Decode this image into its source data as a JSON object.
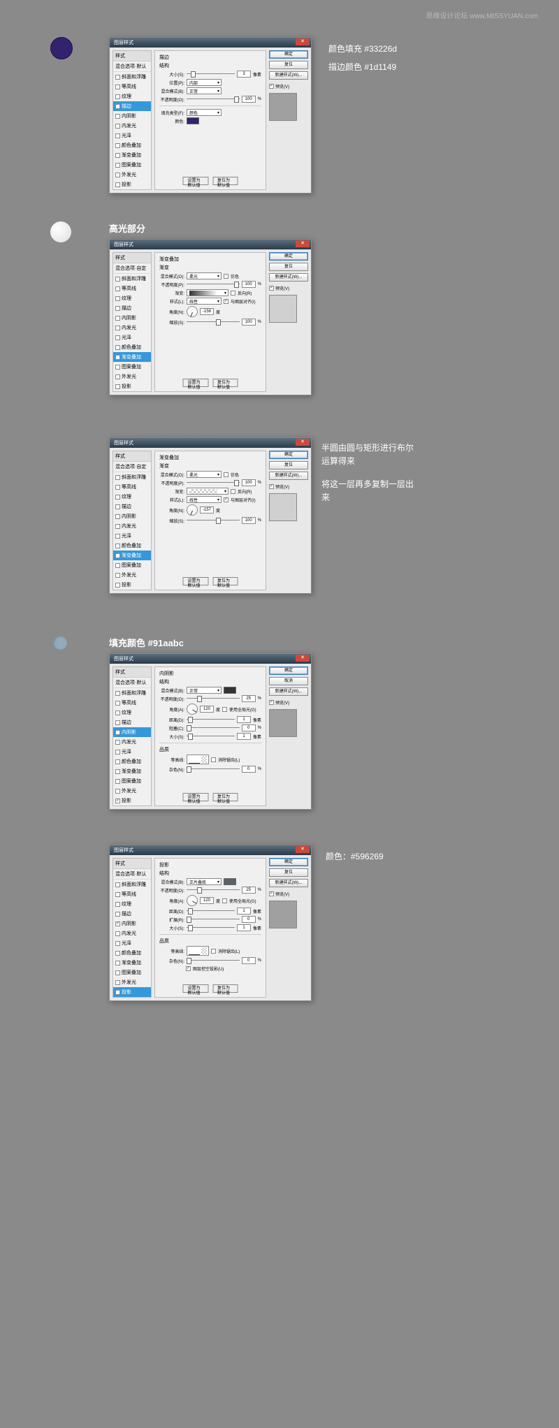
{
  "watermark": "思缘设计论坛 www.MISSYUAN.com",
  "dialogTitle": "图层样式",
  "stylesHeader": "样式",
  "blendDefault": "混合选项·默认",
  "blendCustom": "混合选项·自定",
  "styleItems": [
    "斜面和浮雕",
    "等高线",
    "纹理",
    "描边",
    "内阴影",
    "内发光",
    "光泽",
    "颜色叠加",
    "渐变叠加",
    "图案叠加",
    "外发光",
    "投影"
  ],
  "buttons": {
    "ok": "确定",
    "cancel": "取消",
    "reset": "复位",
    "newStyle": "新建样式(W)...",
    "preview": "预览(V)",
    "defaults": "设置为默认值",
    "resetDefaults": "复位为默认值"
  },
  "s1": {
    "panel": "描边",
    "struct": "结构",
    "size": "大小(S):",
    "sizeVal": "3",
    "pos": "位置(P):",
    "posVal": "内部",
    "blend": "混合模式(B):",
    "blendVal": "正常",
    "opacity": "不透明度(O):",
    "opacityVal": "100",
    "fillType": "填充类型(F):",
    "fillTypeVal": "颜色",
    "color": "颜色:",
    "px": "像素",
    "pct": "%",
    "annot1": "颜色填充 #33226d",
    "annot2": "描边颜色 #1d1149"
  },
  "hl": "高光部分",
  "s2": {
    "panel": "渐变叠加",
    "grad": "渐变",
    "blend": "混合模式(O):",
    "blendVal": "柔光",
    "dither": "仿色",
    "opacity": "不透明度(P):",
    "opacityVal": "100",
    "gradLbl": "渐变:",
    "reverse": "反向(R)",
    "style": "样式(L):",
    "styleVal": "线性",
    "align": "与图层对齐(I)",
    "angle": "角度(N):",
    "angleVal": "-158",
    "deg": "度",
    "scale": "缩放(S):",
    "scaleVal": "100",
    "pct": "%"
  },
  "s3": {
    "angleVal": "-157",
    "annot1": "半圆由圆与矩形进行布尔运算得来",
    "annot2": "将这一层再多复制一层出来"
  },
  "s4": {
    "title": "填充颜色 #91aabc",
    "panel": "内阴影",
    "struct": "结构",
    "blend": "混合模式(B):",
    "blendVal": "正常",
    "opacity": "不透明度(O):",
    "opacityVal": "25",
    "angle": "角度(A):",
    "angleVal": "120",
    "deg": "度",
    "global": "使用全局光(G)",
    "dist": "距离(D):",
    "distVal": "1",
    "px": "像素",
    "choke": "阻塞(C):",
    "chokeVal": "0",
    "size": "大小(S):",
    "sizeVal": "1",
    "quality": "品质",
    "contour": "等高线:",
    "anti": "消除锯齿(L)",
    "noise": "杂色(N):",
    "noiseVal": "0",
    "pct": "%"
  },
  "s5": {
    "panel": "投影",
    "struct": "结构",
    "blend": "混合模式(B):",
    "blendVal": "正片叠底",
    "opacity": "不透明度(O):",
    "opacityVal": "25",
    "angle": "角度(A):",
    "angleVal": "120",
    "deg": "度",
    "global": "使用全局光(G)",
    "dist": "距离(D):",
    "distVal": "1",
    "px": "像素",
    "spread": "扩展(R):",
    "spreadVal": "0",
    "size": "大小(S):",
    "sizeVal": "1",
    "quality": "品质",
    "contour": "等高线:",
    "anti": "消除锯齿(L)",
    "noise": "杂色(N):",
    "noiseVal": "0",
    "knock": "图层挖空投影(U)",
    "pct": "%",
    "annot": "颜色：#596269"
  }
}
